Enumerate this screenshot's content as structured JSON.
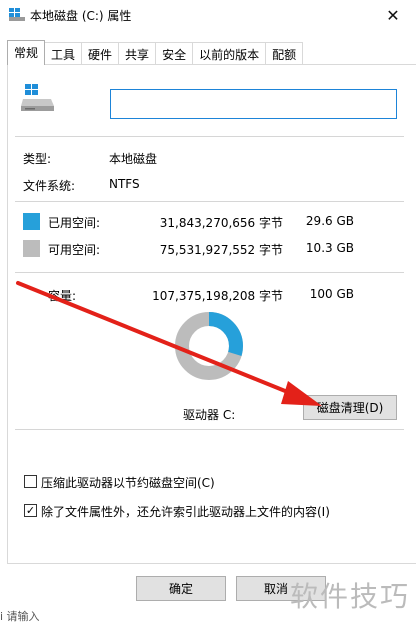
{
  "window": {
    "title": "本地磁盘 (C:) 属性",
    "close_glyph": "✕"
  },
  "tabs": [
    {
      "label": "常规",
      "active": true
    },
    {
      "label": "工具",
      "active": false
    },
    {
      "label": "硬件",
      "active": false
    },
    {
      "label": "共享",
      "active": false
    },
    {
      "label": "安全",
      "active": false
    },
    {
      "label": "以前的版本",
      "active": false
    },
    {
      "label": "配额",
      "active": false
    }
  ],
  "general": {
    "name_value": "",
    "type_label": "类型:",
    "type_value": "本地磁盘",
    "fs_label": "文件系统:",
    "fs_value": "NTFS",
    "used_label": "已用空间:",
    "used_bytes": "31,843,270,656 字节",
    "used_size": "29.6 GB",
    "free_label": "可用空间:",
    "free_bytes": "75,531,927,552 字节",
    "free_size": "10.3 GB",
    "capacity_label": "容量:",
    "capacity_bytes": "107,375,198,208 字节",
    "capacity_size": "100 GB",
    "drive_label": "驱动器 C:",
    "cleanup_button": "磁盘清理(D)",
    "compress_label": "压缩此驱动器以节约磁盘空间(C)",
    "compress_checked": false,
    "index_label": "除了文件属性外，还允许索引此驱动器上文件的内容(I)",
    "index_checked": true,
    "used_fraction": 0.297
  },
  "footer": {
    "ok_button": "确定",
    "cancel_button": "取消"
  },
  "overlay": {
    "watermark": "软件技巧",
    "bottom_fragment": "i 请输入"
  },
  "colors": {
    "used": "#26a0da",
    "free": "#bcbcbc",
    "arrow": "#e32119"
  },
  "icons": {
    "drive": "drive-icon",
    "checkmark": "✓"
  }
}
